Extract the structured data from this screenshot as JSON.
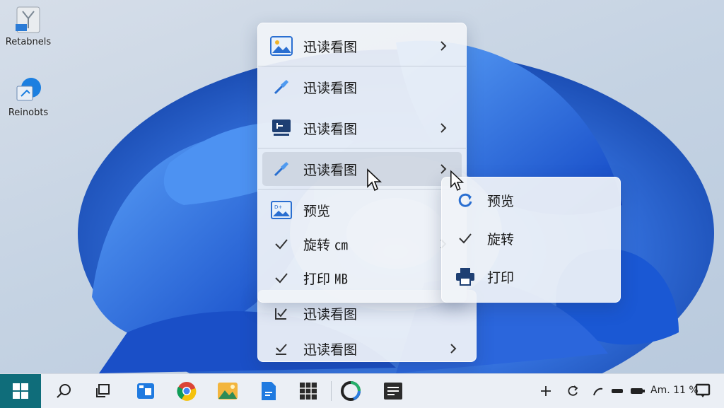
{
  "desktop": {
    "icons": [
      {
        "label": "Retabnels",
        "icon": "folder-shortcut-icon"
      },
      {
        "label": "Reinobts",
        "icon": "app-shortcut-icon"
      }
    ]
  },
  "context_menu": {
    "items": [
      {
        "label": "迅读看图",
        "icon": "image-icon",
        "has_submenu": true
      },
      {
        "label": "迅读看图",
        "icon": "brush-icon",
        "has_submenu": false
      },
      {
        "label": "迅读看图",
        "icon": "screen-icon",
        "has_submenu": true
      },
      {
        "label": "迅读看图",
        "icon": "brush-icon",
        "has_submenu": true,
        "highlighted": true
      },
      {
        "label": "预览",
        "icon": "image-icon",
        "has_submenu": false
      },
      {
        "label": "旋转 ㎝",
        "icon": "check-icon",
        "has_submenu": true
      },
      {
        "label": "打印 ㎆",
        "icon": "check-icon",
        "has_submenu": false
      }
    ],
    "behind_items": [
      {
        "label": "迅读看图",
        "icon": "checkbox-icon"
      },
      {
        "label": "迅读看图",
        "icon": "checkbox-icon"
      }
    ]
  },
  "submenu": {
    "items": [
      {
        "label": "预览",
        "icon": "refresh-icon"
      },
      {
        "label": "旋转",
        "icon": "check-icon"
      },
      {
        "label": "打印",
        "icon": "printer-icon"
      }
    ]
  },
  "taskbar": {
    "tray_text": "Am. 11 %",
    "accent": "#0f6d7a",
    "icons": [
      "start-icon",
      "search-icon",
      "task-view-icon",
      "photos-app-icon",
      "chrome-icon",
      "gallery-icon",
      "document-icon",
      "grid-app-icon",
      "edge-icon",
      "terminal-icon"
    ]
  }
}
